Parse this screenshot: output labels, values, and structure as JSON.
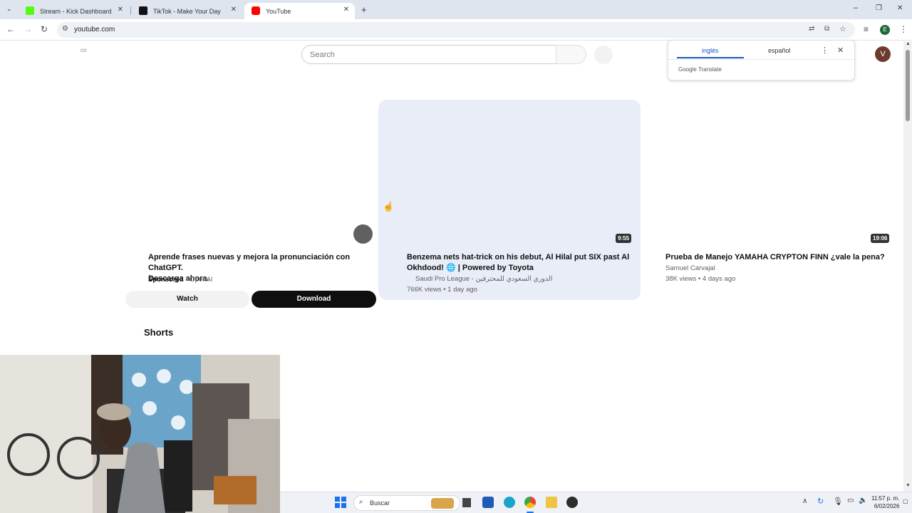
{
  "browser": {
    "tabs": [
      {
        "label": "Stream - Kick Dashboard",
        "favicon_color": "#53fc18"
      },
      {
        "label": "TikTok - Make Your Day",
        "favicon_color": "#111111"
      },
      {
        "label": "YouTube",
        "favicon_color": "#ff0000"
      }
    ],
    "url": "youtube.com"
  },
  "youtube": {
    "logo_text": "co",
    "search_placeholder": "Search",
    "avatar_letter": "V",
    "ad": {
      "title_line1": "Aprende frases nuevas y mejora la pronunciación con ChatGPT.",
      "title_line2": "Descarga ahora.",
      "sponsored": "Sponsored",
      "advertiser": "OpenAI",
      "watch_label": "Watch",
      "download_label": "Download"
    },
    "videos": [
      {
        "title_line1": "Benzema nets hat-trick on his debut, Al Hilal put SIX past Al",
        "title_line2": "Okhdood! 🌐 | Powered by Toyota",
        "channel": "Saudi Pro League - الدوري السعودي للمحترفين",
        "meta": "766K views • 1 day ago",
        "duration": "9:55"
      },
      {
        "title_line1": "Prueba de Manejo YAMAHA CRYPTON FINN ¿vale la pena?",
        "channel": "Samuel Carvajal",
        "meta": "38K views • 4 days ago",
        "duration": "19:06"
      }
    ],
    "shorts_heading": "Shorts"
  },
  "translate_popup": {
    "source_lang": "inglés",
    "target_lang": "español",
    "brand": "Google Translate"
  },
  "taskbar": {
    "search_label": "Buscar",
    "time": "11:57 p. m.",
    "date": "6/02/2026"
  }
}
